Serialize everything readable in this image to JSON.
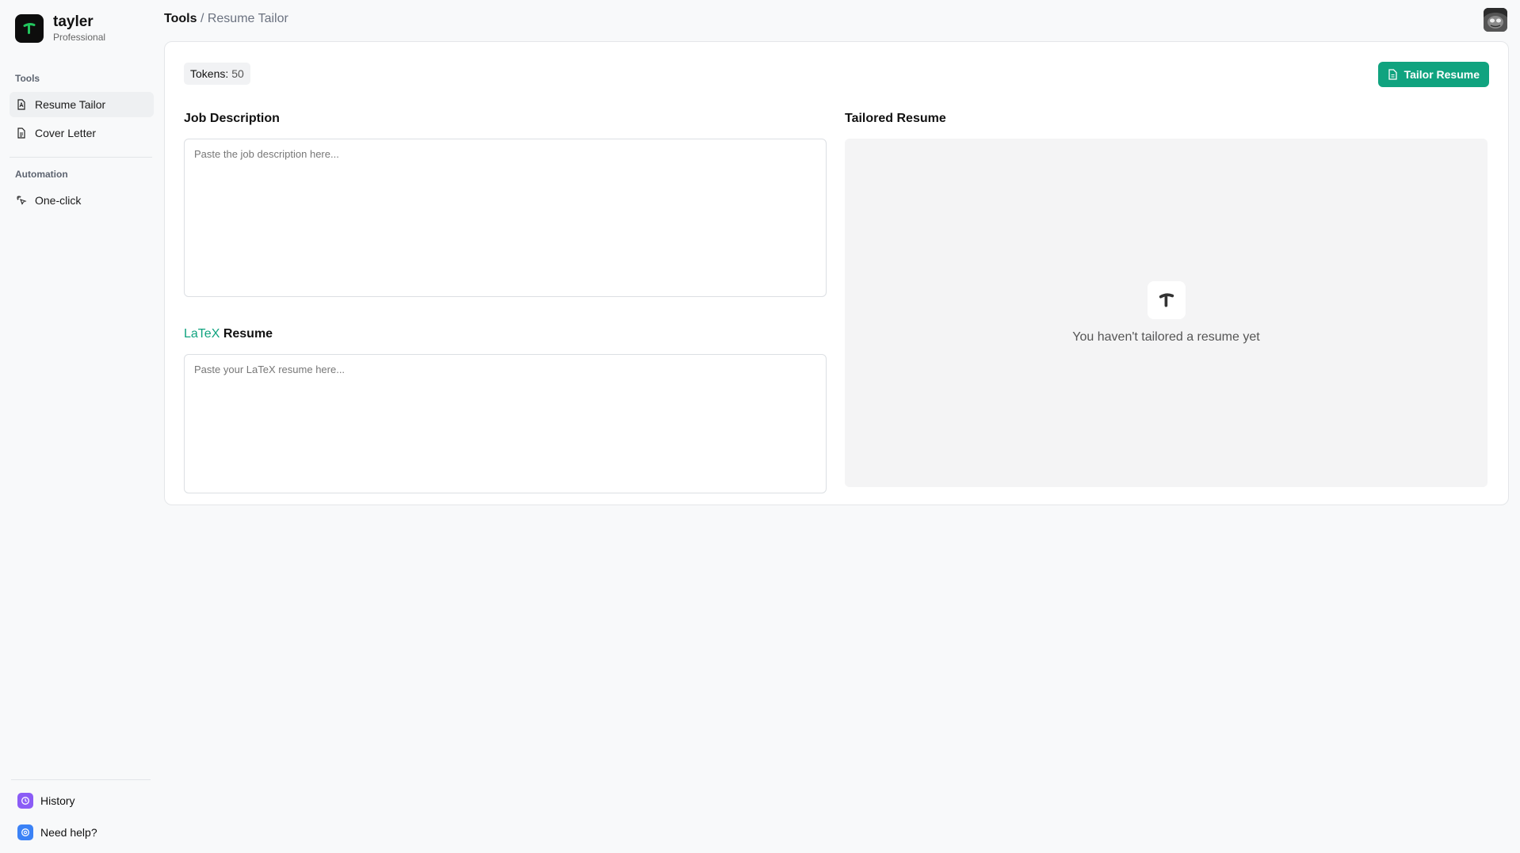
{
  "brand": {
    "name": "tayler",
    "plan": "Professional"
  },
  "sidebar": {
    "tools_label": "Tools",
    "tools": [
      {
        "label": "Resume Tailor",
        "icon": "resume-icon",
        "active": true
      },
      {
        "label": "Cover Letter",
        "icon": "document-icon",
        "active": false
      }
    ],
    "automation_label": "Automation",
    "automation": [
      {
        "label": "One-click",
        "icon": "sparkle-click-icon"
      }
    ],
    "bottom": [
      {
        "label": "History",
        "icon": "history-icon",
        "color": "#8b5cf6"
      },
      {
        "label": "Need help?",
        "icon": "help-icon",
        "color": "#3b82f6"
      }
    ]
  },
  "header": {
    "root": "Tools",
    "separator": "/",
    "current": "Resume Tailor"
  },
  "main": {
    "tokens_label": "Tokens:",
    "tokens_value": "50",
    "tailor_button": "Tailor Resume",
    "job_description_label": "Job Description",
    "job_description_placeholder": "Paste the job description here...",
    "latex_label_accent": "LaTeX",
    "latex_label_rest": " Resume",
    "latex_placeholder": "Paste your LaTeX resume here...",
    "tailored_label": "Tailored Resume",
    "empty_state": "You haven't tailored a resume yet"
  },
  "colors": {
    "accent": "#10a37f",
    "background": "#f8f9fa"
  }
}
